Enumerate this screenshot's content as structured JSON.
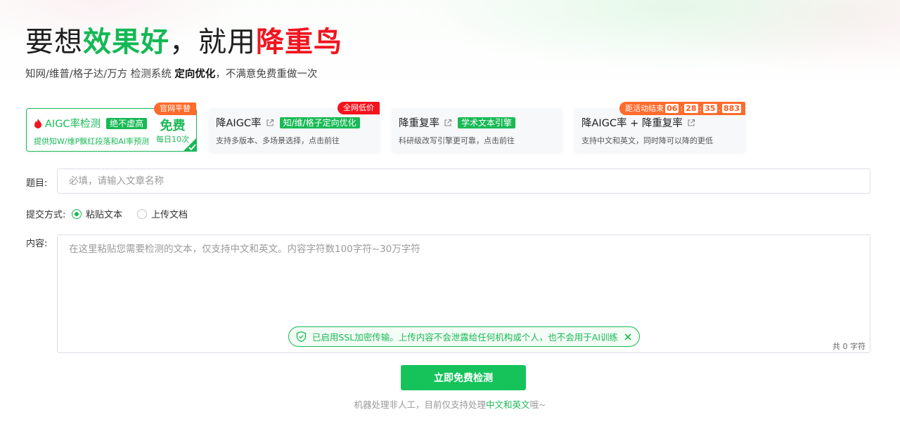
{
  "colors": {
    "brand_green": "#19b955",
    "brand_red": "#f0151f",
    "ribbon_orange": "#ff6b2c"
  },
  "header": {
    "title_part1": "要想",
    "title_part2": "效果好",
    "title_part3": "，就用",
    "title_part4": "降重鸟",
    "subtitle_pre": "知网/维普/格子达/万方 检测系统 ",
    "subtitle_bold": "定向优化",
    "subtitle_post": "，不满意免费重做一次"
  },
  "cards": [
    {
      "icon": "fire-icon",
      "title": "AIGC率检测",
      "tag": "绝不虚高",
      "desc": "提供知W/维P飘红段落和AI率预测",
      "ribbon": "官网平替",
      "free_label": "免费",
      "daily_label": "每日10次"
    },
    {
      "title": "降AIGC率",
      "tag": "知/维/格子定向优化",
      "desc": "支持多版本、多场景选择，点击前往",
      "ribbon": "全网低价"
    },
    {
      "title": "降重复率",
      "tag": "学术文本引擎",
      "desc": "科研级改写引擎更可靠，点击前往"
    },
    {
      "title": "降AIGC率 + 降重复率",
      "desc": "支持中文和英文，同时降可以降的更低",
      "countdown_label": "距活动结束",
      "countdown": [
        "06",
        "28",
        "35",
        "883"
      ]
    }
  ],
  "form": {
    "title_label": "题目:",
    "title_placeholder": "必填，请输入文章名称",
    "method_label": "提交方式:",
    "method_options": [
      "粘贴文本",
      "上传文档"
    ],
    "method_selected": "粘贴文本",
    "content_label": "内容:",
    "content_placeholder": "在这里粘贴您需要检测的文本，仅支持中文和英文。内容字符数100字符~30万字符",
    "ssl_notice": "已启用SSL加密传输。上传内容不会泄露给任何机构或个人，也不会用于AI训练",
    "count_text": "共 0 字符",
    "submit_label": "立即免费检测"
  },
  "footer": {
    "note_pre": "机器处理非人工，目前仅支持处理",
    "note_highlight": "中文和英文",
    "note_post": "哦~"
  }
}
